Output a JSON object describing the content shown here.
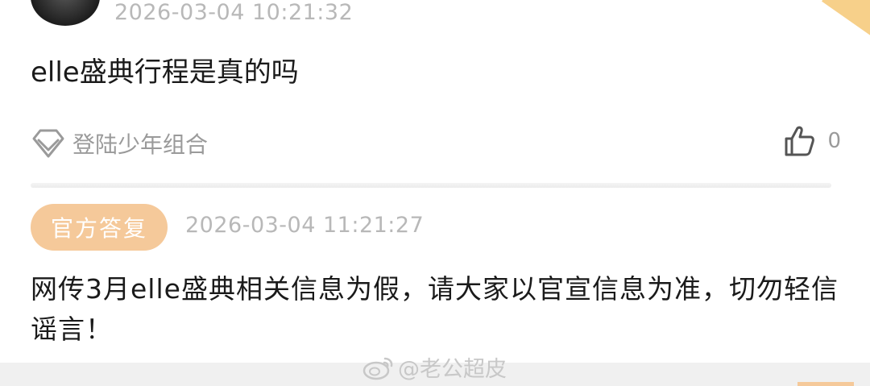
{
  "question": {
    "timestamp": "2026-03-04 10:21:32",
    "text": "elle盛典行程是真的吗"
  },
  "tag": {
    "icon": "diamond-icon",
    "label": "登陆少年组合"
  },
  "like": {
    "icon": "thumbs-up-icon",
    "count": "0"
  },
  "answer": {
    "badge": "官方答复",
    "timestamp": "2026-03-04 11:21:27",
    "text": "网传3月elle盛典相关信息为假，请大家以官宣信息为准，切勿轻信谣言！"
  },
  "watermark": {
    "icon": "weibo-icon",
    "text": "@老公超皮"
  },
  "colors": {
    "badge_bg": "#f5c99a",
    "muted_text": "#9a9a9a",
    "timestamp_text": "#b8b8b8"
  }
}
